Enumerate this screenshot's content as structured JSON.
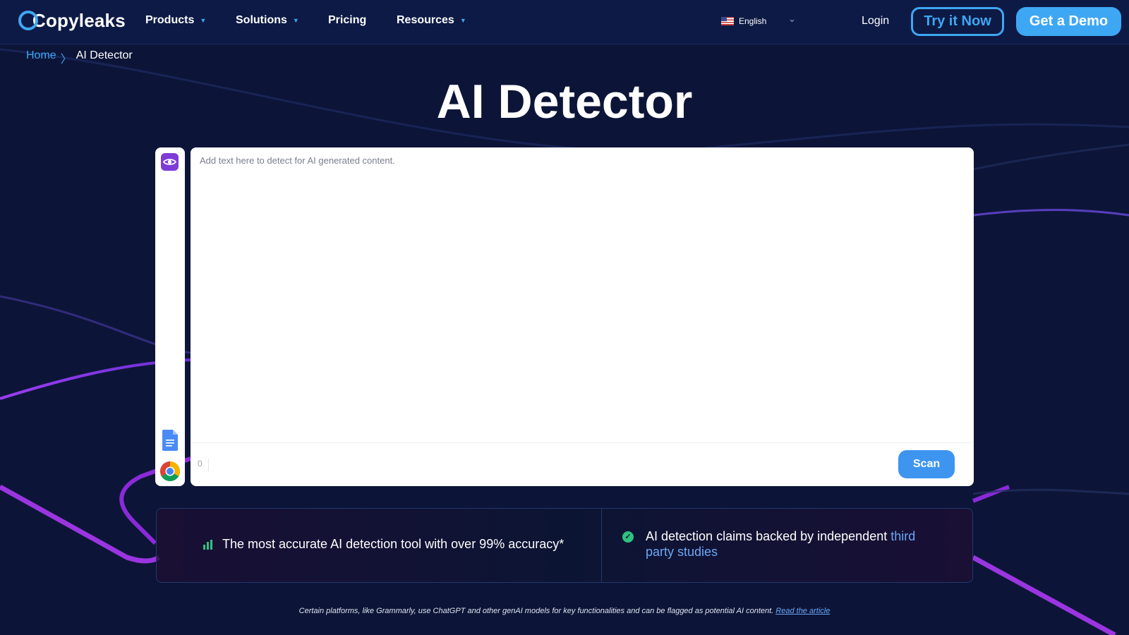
{
  "nav": {
    "logo_text": "Copyleaks",
    "items": [
      {
        "label": "Products",
        "has_caret": true
      },
      {
        "label": "Solutions",
        "has_caret": true
      },
      {
        "label": "Pricing",
        "has_caret": false
      },
      {
        "label": "Resources",
        "has_caret": true
      }
    ],
    "language": "English",
    "login": "Login",
    "try_button": "Try it Now",
    "demo_button": "Get a Demo"
  },
  "breadcrumb": {
    "home": "Home",
    "separator": "〉",
    "current": "AI Detector"
  },
  "title": "AI Detector",
  "editor": {
    "placeholder": "Add text here to detect for AI generated content.",
    "char_count": "0",
    "scan_button": "Scan"
  },
  "features": {
    "left": "The most accurate AI detection tool with over 99% accuracy*",
    "right_text": "AI detection claims backed by independent ",
    "right_link": "third party studies"
  },
  "footnote": {
    "text": "Certain platforms, like Grammarly, use ChatGPT and other genAI models for key functionalities and can be flagged as potential AI content. ",
    "link": "Read the article"
  },
  "icons": {
    "logo": "copyleaks-logo-icon",
    "eye": "eye-icon",
    "google_docs": "google-docs-icon",
    "chrome": "chrome-icon",
    "flag": "us-flag-icon",
    "bar_chart": "bar-chart-icon",
    "check": "check-circle-icon"
  },
  "colors": {
    "background": "#0c1538",
    "nav_background": "#0d1a45",
    "accent_blue": "#3ea7f3",
    "scan_blue": "#3e95f0",
    "purple": "#7e3bd6",
    "green": "#2ec27e"
  }
}
